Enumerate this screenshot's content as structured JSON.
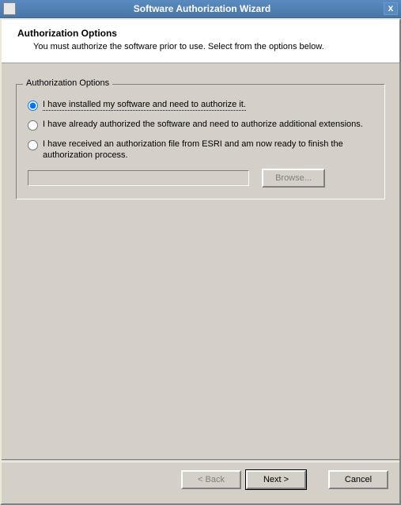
{
  "window": {
    "title": "Software Authorization Wizard",
    "close_icon": "x"
  },
  "header": {
    "title": "Authorization Options",
    "subtitle": "You must authorize the software prior to use. Select from the options below."
  },
  "groupbox": {
    "legend": "Authorization Options",
    "options": [
      {
        "label": "I have installed my software and need to authorize it.",
        "checked": true
      },
      {
        "label": "I have already authorized the software and need to authorize additional extensions.",
        "checked": false
      },
      {
        "label": "I have received an authorization file from ESRI and am now ready to finish the authorization process.",
        "checked": false
      }
    ],
    "path_value": "",
    "browse_label": "Browse..."
  },
  "footer": {
    "back": "< Back",
    "next": "Next >",
    "cancel": "Cancel"
  }
}
